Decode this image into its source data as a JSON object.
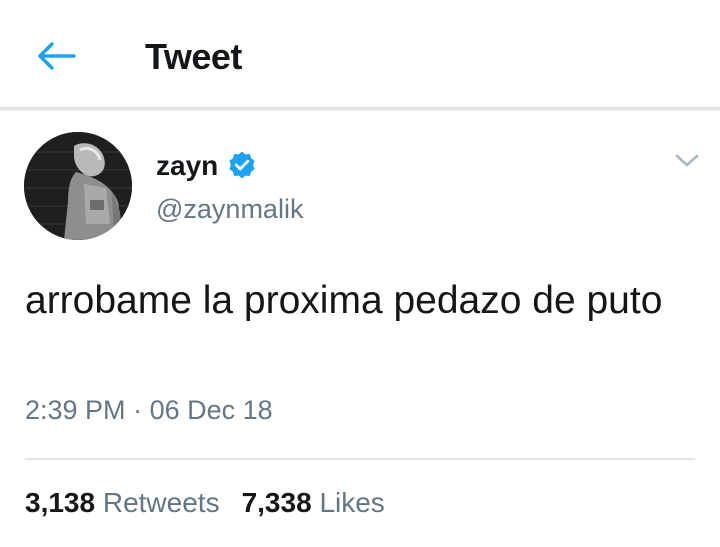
{
  "header": {
    "title": "Tweet",
    "back_icon": "arrow-left-icon",
    "accent_color": "#1da1f2"
  },
  "tweet": {
    "author": {
      "name": "zayn",
      "handle": "@zaynmalik",
      "verified": true,
      "verified_icon": "verified-badge-icon"
    },
    "menu_icon": "chevron-down-icon",
    "text": "arrobame la proxima pedazo de puto",
    "time": "2:39 PM",
    "separator": "·",
    "date": "06 Dec 18"
  },
  "stats": {
    "retweets_count": "3,138",
    "retweets_label": "Retweets",
    "likes_count": "7,338",
    "likes_label": "Likes"
  },
  "colors": {
    "text_primary": "#14171a",
    "text_secondary": "#657786",
    "divider": "#e1e6ea"
  }
}
